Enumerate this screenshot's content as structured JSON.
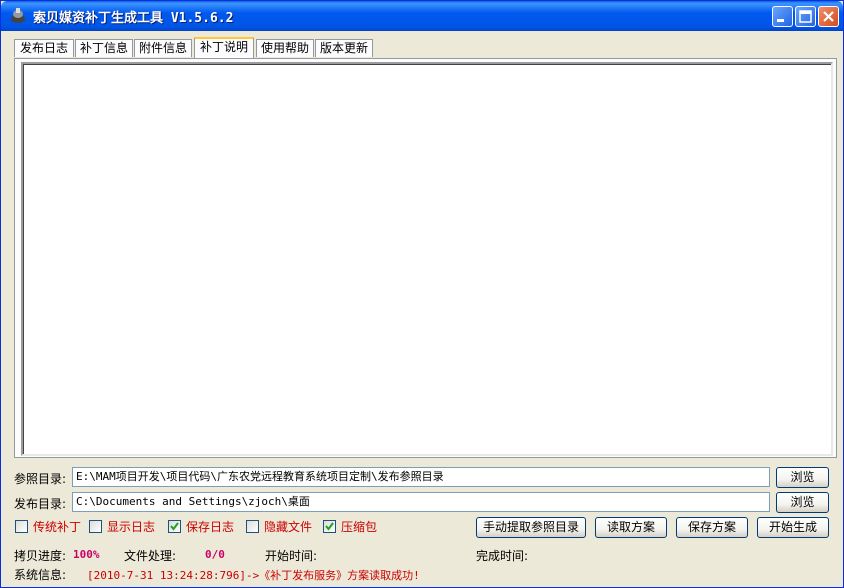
{
  "window": {
    "title": "索贝媒资补丁生成工具 V1.5.6.2"
  },
  "tabs": [
    {
      "label": "发布日志",
      "active": false
    },
    {
      "label": "补丁信息",
      "active": false
    },
    {
      "label": "附件信息",
      "active": false
    },
    {
      "label": "补丁说明",
      "active": true
    },
    {
      "label": "使用帮助",
      "active": false
    },
    {
      "label": "版本更新",
      "active": false
    }
  ],
  "paths": {
    "reference_label": "参照目录:",
    "reference_value": "E:\\MAM项目开发\\项目代码\\广东农党远程教育系统项目定制\\发布参照目录",
    "publish_label": "发布目录:",
    "publish_value": "C:\\Documents and Settings\\zjoch\\桌面",
    "browse_label": "浏览"
  },
  "options": [
    {
      "label": "传统补丁",
      "checked": false
    },
    {
      "label": "显示日志",
      "checked": false
    },
    {
      "label": "保存日志",
      "checked": true
    },
    {
      "label": "隐藏文件",
      "checked": false
    },
    {
      "label": "压缩包",
      "checked": true
    }
  ],
  "actions": {
    "extract": "手动提取参照目录",
    "read": "读取方案",
    "save": "保存方案",
    "start": "开始生成"
  },
  "status": {
    "copy_progress_label": "拷贝进度:",
    "copy_progress_value": "100%",
    "file_process_label": "文件处理:",
    "file_process_value": "0/0",
    "start_time_label": "开始时间:",
    "finish_time_label": "完成时间:",
    "system_info_label": "系统信息:",
    "system_info_value": "[2010-7-31 13:24:28:796]->《补丁发布服务》方案读取成功!"
  },
  "colors": {
    "accent_red": "#cc0000",
    "progress_magenta": "#cc0066"
  }
}
